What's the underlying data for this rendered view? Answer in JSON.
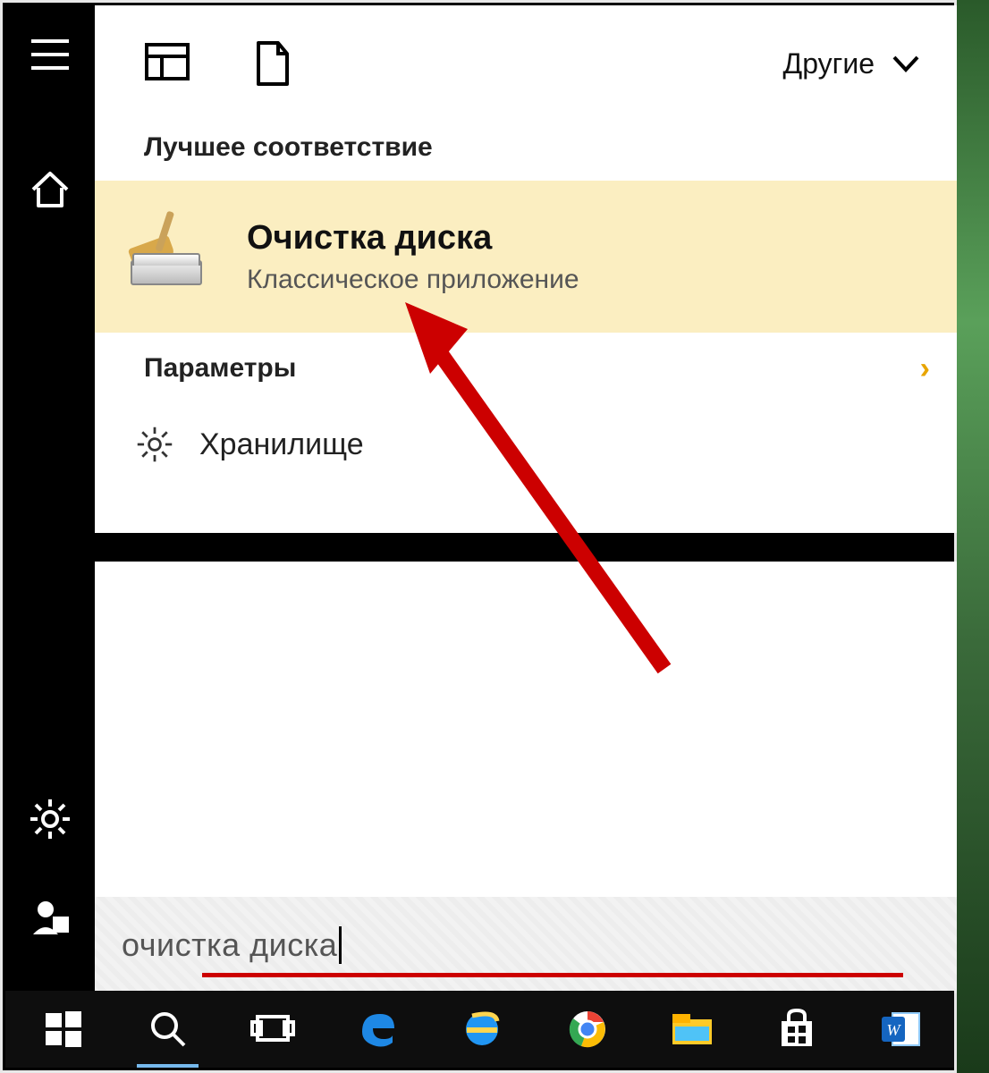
{
  "top_filters": {
    "other_label": "Другие"
  },
  "sections": {
    "best_match_label": "Лучшее соответствие",
    "settings_label": "Параметры"
  },
  "best_match": {
    "title": "Очистка диска",
    "subtitle": "Классическое приложение"
  },
  "settings_items": {
    "storage": "Хранилище"
  },
  "search": {
    "query": "очистка диска"
  },
  "sidebar_icons": {
    "hamburger": "menu-icon",
    "home": "home-icon",
    "settings": "gear-icon",
    "account": "account-icon"
  },
  "taskbar": {
    "items": [
      "start",
      "search",
      "task-view",
      "edge",
      "ie",
      "chrome",
      "explorer",
      "store",
      "word"
    ]
  },
  "colors": {
    "highlight_bg": "#fbeec1",
    "accent_arrow": "#e8a500",
    "annotation_red": "#cc0000"
  }
}
